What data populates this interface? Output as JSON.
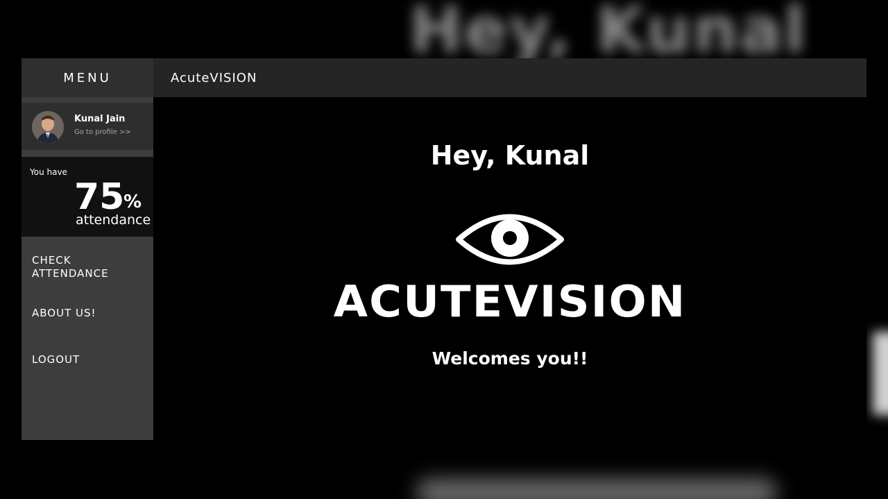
{
  "background": {
    "blurred_title": "Hey, Kunal"
  },
  "sidebar": {
    "menu_title": "MENU",
    "profile": {
      "name": "Kunal Jain",
      "link": "Go to profile >>"
    },
    "attendance": {
      "prefix": "You have",
      "value": "75",
      "unit": "%",
      "suffix": "attendance"
    },
    "items": [
      {
        "label": "CHECK\nATTENDANCE"
      },
      {
        "label": "ABOUT US!"
      },
      {
        "label": "LOGOUT"
      }
    ]
  },
  "header": {
    "brand": "AcuteVISION"
  },
  "main": {
    "greeting": "Hey, Kunal",
    "logo_icon": "eye-icon",
    "logo_text": "ACUTEVISION",
    "tagline": "Welcomes you!!"
  },
  "colors": {
    "sidebar": "#3d3d3d",
    "header": "#252525",
    "background": "#000000",
    "text": "#ffffff"
  }
}
